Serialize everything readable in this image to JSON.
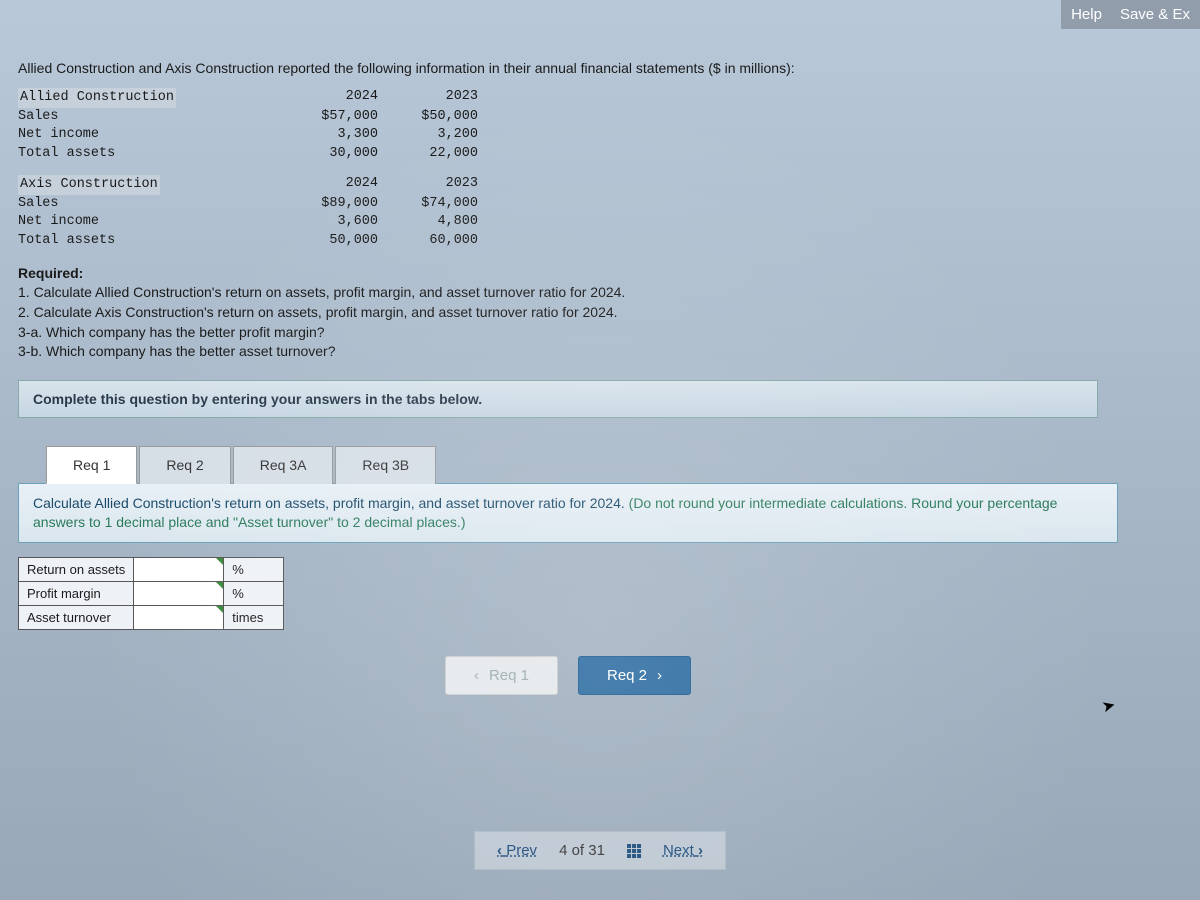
{
  "topbar": {
    "help": "Help",
    "save_exit": "Save & Ex"
  },
  "intro": "Allied Construction and Axis Construction reported the following information in their annual financial statements ($ in millions):",
  "tables": {
    "allied": {
      "name": "Allied Construction",
      "years": [
        "2024",
        "2023"
      ],
      "rows": [
        {
          "label": "Sales",
          "v2024": "$57,000",
          "v2023": "$50,000"
        },
        {
          "label": "Net income",
          "v2024": "3,300",
          "v2023": "3,200"
        },
        {
          "label": "Total assets",
          "v2024": "30,000",
          "v2023": "22,000"
        }
      ]
    },
    "axis": {
      "name": "Axis Construction",
      "years": [
        "2024",
        "2023"
      ],
      "rows": [
        {
          "label": "Sales",
          "v2024": "$89,000",
          "v2023": "$74,000"
        },
        {
          "label": "Net income",
          "v2024": "3,600",
          "v2023": "4,800"
        },
        {
          "label": "Total assets",
          "v2024": "50,000",
          "v2023": "60,000"
        }
      ]
    }
  },
  "required": {
    "heading": "Required:",
    "items": [
      "1. Calculate Allied Construction's return on assets, profit margin, and asset turnover ratio for 2024.",
      "2. Calculate Axis Construction's return on assets, profit margin, and asset turnover ratio for 2024.",
      "3-a. Which company has the better profit margin?",
      "3-b. Which company has the better asset turnover?"
    ]
  },
  "instruction": "Complete this question by entering your answers in the tabs below.",
  "tabs": {
    "items": [
      "Req 1",
      "Req 2",
      "Req 3A",
      "Req 3B"
    ],
    "active": "Req 1"
  },
  "tab_content": {
    "prompt_main": "Calculate Allied Construction's return on assets, profit margin, and asset turnover ratio for 2024. ",
    "prompt_note": "(Do not round your intermediate calculations. Round your percentage answers to 1 decimal place and \"Asset turnover\" to 2 decimal places.)",
    "rows": [
      {
        "label": "Return on assets",
        "unit": "%"
      },
      {
        "label": "Profit margin",
        "unit": "%"
      },
      {
        "label": "Asset turnover",
        "unit": "times"
      }
    ]
  },
  "inner_nav": {
    "prev": "Req 1",
    "next": "Req 2"
  },
  "bottom_nav": {
    "prev": "Prev",
    "counter": "4 of 31",
    "next": "Next"
  }
}
